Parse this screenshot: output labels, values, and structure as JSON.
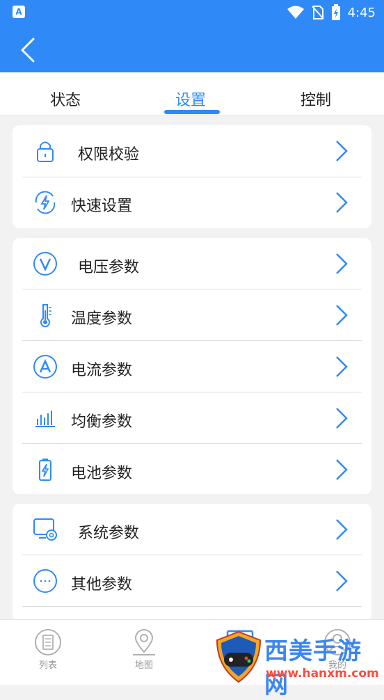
{
  "status_bar": {
    "time": "4:45",
    "left_icon": "A"
  },
  "tabs": [
    {
      "label": "状态",
      "active": false
    },
    {
      "label": "设置",
      "active": true
    },
    {
      "label": "控制",
      "active": false
    }
  ],
  "sections": [
    {
      "items": [
        {
          "label": "权限校验",
          "icon": "lock-icon"
        },
        {
          "label": "快速设置",
          "icon": "quick-settings-icon"
        }
      ]
    },
    {
      "items": [
        {
          "label": "电压参数",
          "icon": "voltage-icon"
        },
        {
          "label": "温度参数",
          "icon": "thermometer-icon"
        },
        {
          "label": "电流参数",
          "icon": "current-icon"
        },
        {
          "label": "均衡参数",
          "icon": "balance-bars-icon"
        },
        {
          "label": "电池参数",
          "icon": "battery-icon"
        }
      ]
    },
    {
      "items": [
        {
          "label": "系统参数",
          "icon": "system-settings-icon"
        },
        {
          "label": "其他参数",
          "icon": "more-icon"
        }
      ]
    }
  ],
  "bottom_nav": [
    {
      "label": "列表",
      "icon": "list-icon"
    },
    {
      "label": "地图",
      "icon": "map-pin-icon"
    },
    {
      "label": "",
      "icon": "card-icon"
    },
    {
      "label": "我的",
      "icon": "profile-icon"
    }
  ],
  "watermark": {
    "title": "西美手游网",
    "url": "www.hanxm.com"
  },
  "colors": {
    "primary": "#2f8af7",
    "text": "#222222",
    "divider": "#dcdcdc",
    "background": "#f2f2f2"
  }
}
